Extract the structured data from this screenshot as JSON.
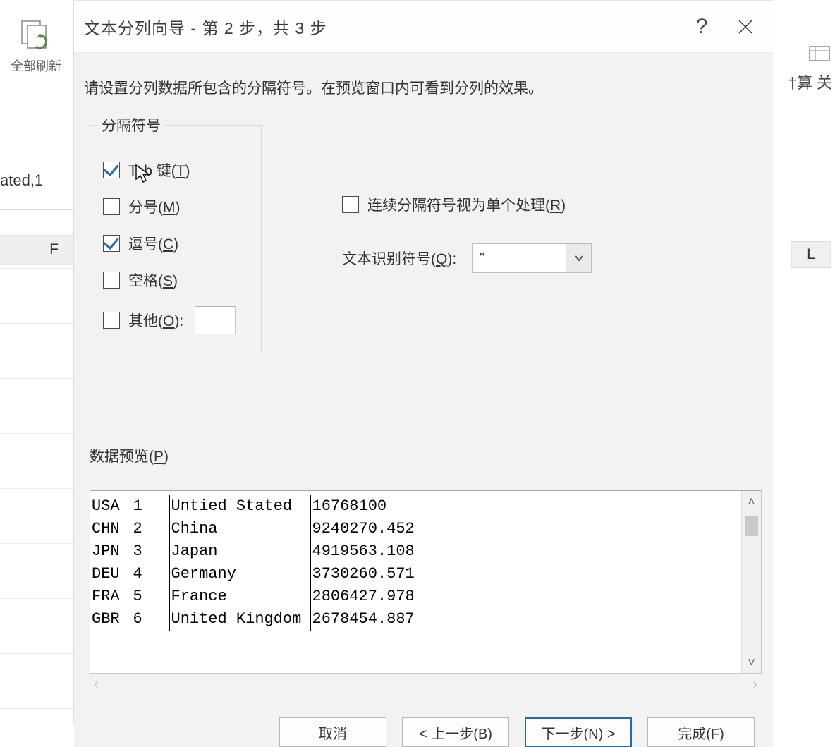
{
  "background": {
    "refresh_label": "全部刷新",
    "cell_peek": "ated,1",
    "col_F": "F",
    "col_L": "L",
    "right_labels": "†算  关"
  },
  "dialog": {
    "title": "文本分列向导 - 第 2 步，共 3 步",
    "instructions": "请设置分列数据所包含的分隔符号。在预览窗口内可看到分列的效果。",
    "delim_legend": "分隔符号",
    "tab_label_pre": "Ta",
    "tab_label_post": " 键(",
    "tab_hotkey": "T",
    "semicolon_label": "分号(",
    "semicolon_hotkey": "M",
    "comma_label": "逗号(",
    "comma_hotkey": "C",
    "space_label": "空格(",
    "space_hotkey": "S",
    "other_label": "其他(",
    "other_hotkey": "O",
    "close_paren": ")",
    "close_paren_colon": "):",
    "consecutive_label": "连续分隔符号视为单个处理(",
    "consecutive_hotkey": "R",
    "text_qualifier_label": "文本识别符号(",
    "text_qualifier_hotkey": "Q",
    "text_qualifier_close": "):",
    "text_qualifier_value": "\"",
    "preview_label": "数据预览(",
    "preview_hotkey": "P",
    "preview_rows": [
      [
        "USA",
        "1",
        "Untied Stated",
        "16768100"
      ],
      [
        "CHN",
        "2",
        "China",
        "9240270.452"
      ],
      [
        "JPN",
        "3",
        "Japan",
        "4919563.108"
      ],
      [
        "DEU",
        "4",
        "Germany",
        "3730260.571"
      ],
      [
        "FRA",
        "5",
        "France",
        "2806427.978"
      ],
      [
        "GBR",
        "6",
        "United Kingdom",
        "2678454.887"
      ]
    ],
    "buttons": {
      "cancel": "取消",
      "back": "< 上一步(B)",
      "next": "下一步(N) >",
      "finish": "完成(F)"
    }
  }
}
